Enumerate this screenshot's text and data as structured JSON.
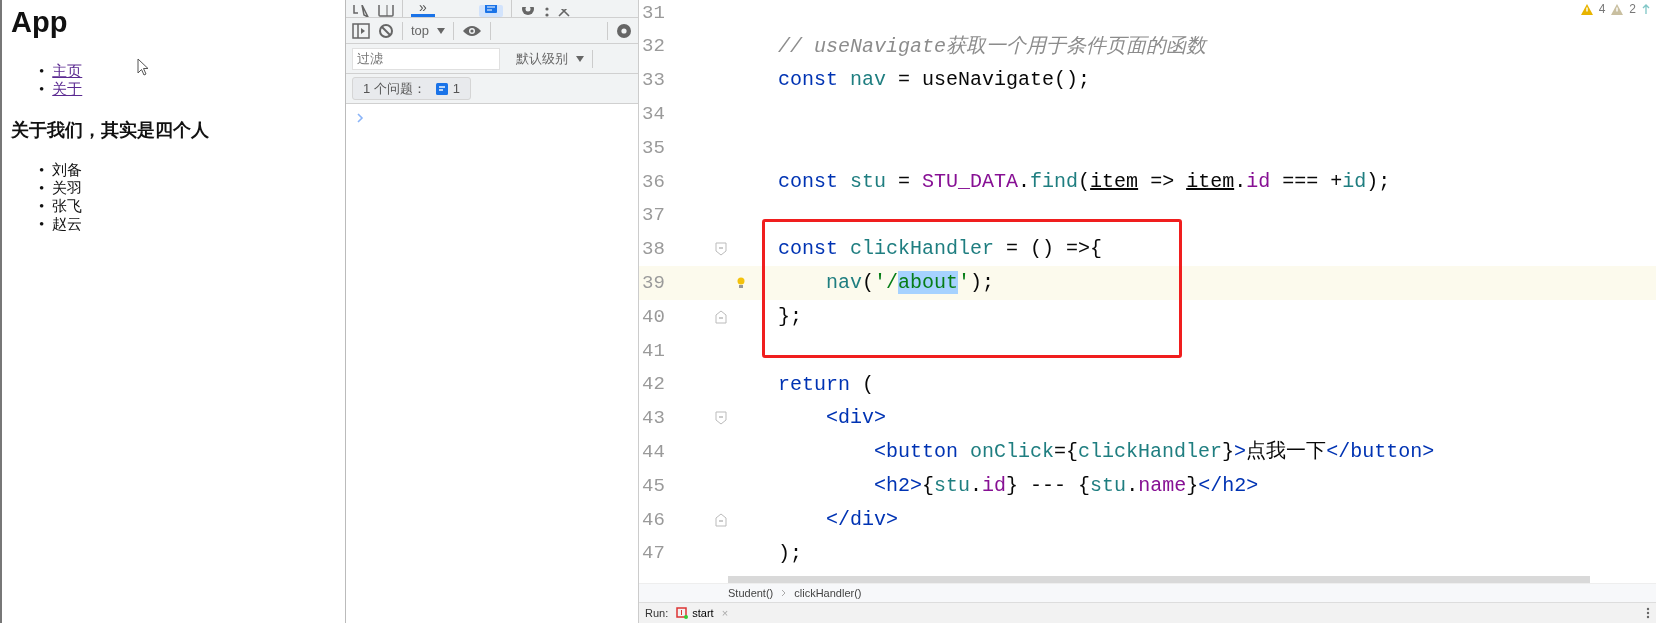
{
  "browser": {
    "title": "App",
    "links": [
      {
        "marker": "•",
        "label": "主页"
      },
      {
        "marker": "•",
        "label": "关于"
      }
    ],
    "heading": "关于我们，其实是四个人",
    "members": [
      {
        "marker": "•",
        "label": "刘备"
      },
      {
        "marker": "•",
        "label": "关羽"
      },
      {
        "marker": "•",
        "label": "张飞"
      },
      {
        "marker": "•",
        "label": "赵云"
      }
    ]
  },
  "devtools": {
    "tabs": [
      {
        "label": "»",
        "selected": true
      }
    ],
    "context": "top",
    "filter": {
      "placeholder": "过滤"
    },
    "level_select": "默认级别",
    "issues": {
      "label": "1 个问题：",
      "count": "1"
    }
  },
  "editor": {
    "inspections": [
      {
        "kind": "warning",
        "count": "4"
      },
      {
        "kind": "weak",
        "count": "2"
      }
    ],
    "lines": [
      {
        "number": "31"
      },
      {
        "number": "32",
        "tokens": [
          {
            "kind": "cmt",
            "text": "// useNavigate获取一个用于条件页面的函数"
          }
        ]
      },
      {
        "number": "33",
        "tokens": [
          {
            "kind": "kw",
            "text": "const "
          },
          {
            "kind": "var",
            "text": "nav"
          },
          {
            "kind": "plain",
            "text": " = useNavigate();"
          }
        ]
      },
      {
        "number": "34"
      },
      {
        "number": "35"
      },
      {
        "number": "36",
        "tokens": [
          {
            "kind": "kw",
            "text": "const "
          },
          {
            "kind": "var",
            "text": "stu"
          },
          {
            "kind": "plain",
            "text": " = "
          },
          {
            "kind": "const",
            "text": "STU_DATA"
          },
          {
            "kind": "plain",
            "text": "."
          },
          {
            "kind": "fn",
            "text": "find"
          },
          {
            "kind": "plain",
            "text": "("
          },
          {
            "kind": "param",
            "text": "item"
          },
          {
            "kind": "plain",
            "text": " => "
          },
          {
            "kind": "param",
            "text": "item"
          },
          {
            "kind": "plain",
            "text": "."
          },
          {
            "kind": "prop",
            "text": "id"
          },
          {
            "kind": "plain",
            "text": " === +"
          },
          {
            "kind": "var",
            "text": "id"
          },
          {
            "kind": "plain",
            "text": ");"
          }
        ]
      },
      {
        "number": "37"
      },
      {
        "number": "38",
        "fold_open": true,
        "boxed": true,
        "tokens": [
          {
            "kind": "kw",
            "text": "const "
          },
          {
            "kind": "var",
            "text": "clickHandler"
          },
          {
            "kind": "plain",
            "text": " = () =>{"
          }
        ]
      },
      {
        "number": "39",
        "current": true,
        "bulb": true,
        "boxed": true,
        "tokens": [
          {
            "kind": "fn",
            "text": "    nav"
          },
          {
            "kind": "plain",
            "text": "("
          },
          {
            "kind": "str",
            "text": "'/"
          },
          {
            "kind": "sel",
            "text": "about"
          },
          {
            "kind": "str",
            "text": "'"
          },
          {
            "kind": "plain",
            "text": ");"
          }
        ]
      },
      {
        "number": "40",
        "fold_close": true,
        "boxed": true,
        "tokens": [
          {
            "kind": "plain",
            "text": "};"
          }
        ]
      },
      {
        "number": "41"
      },
      {
        "number": "42",
        "tokens": [
          {
            "kind": "kw",
            "text": "return"
          },
          {
            "kind": "plain",
            "text": " ("
          }
        ]
      },
      {
        "number": "43",
        "fold_open": true,
        "tokens": [
          {
            "kind": "tag",
            "text": "    <div>"
          }
        ]
      },
      {
        "number": "44",
        "tokens": [
          {
            "kind": "tag",
            "text": "        <button "
          },
          {
            "kind": "attr",
            "text": "onClick"
          },
          {
            "kind": "plain",
            "text": "={"
          },
          {
            "kind": "var",
            "text": "clickHandler"
          },
          {
            "kind": "plain",
            "text": "}"
          },
          {
            "kind": "tag",
            "text": ">"
          },
          {
            "kind": "plain",
            "text": "点我一下"
          },
          {
            "kind": "tag",
            "text": "</button>"
          }
        ]
      },
      {
        "number": "45",
        "tokens": [
          {
            "kind": "tag",
            "text": "        <h2>"
          },
          {
            "kind": "plain",
            "text": "{"
          },
          {
            "kind": "var",
            "text": "stu"
          },
          {
            "kind": "plain",
            "text": "."
          },
          {
            "kind": "prop",
            "text": "id"
          },
          {
            "kind": "plain",
            "text": "} --- {"
          },
          {
            "kind": "var",
            "text": "stu"
          },
          {
            "kind": "plain",
            "text": "."
          },
          {
            "kind": "prop",
            "text": "name"
          },
          {
            "kind": "plain",
            "text": "}"
          },
          {
            "kind": "tag",
            "text": "</h2>"
          }
        ]
      },
      {
        "number": "46",
        "fold_close": true,
        "tokens": [
          {
            "kind": "tag",
            "text": "    </div>"
          }
        ]
      },
      {
        "number": "47",
        "tokens": [
          {
            "kind": "plain",
            "text": ");"
          }
        ]
      }
    ],
    "breadcrumbs": [
      "Student()",
      "clickHandler()"
    ]
  },
  "run_bar": {
    "label": "Run:",
    "tab": "start",
    "close": "×"
  }
}
